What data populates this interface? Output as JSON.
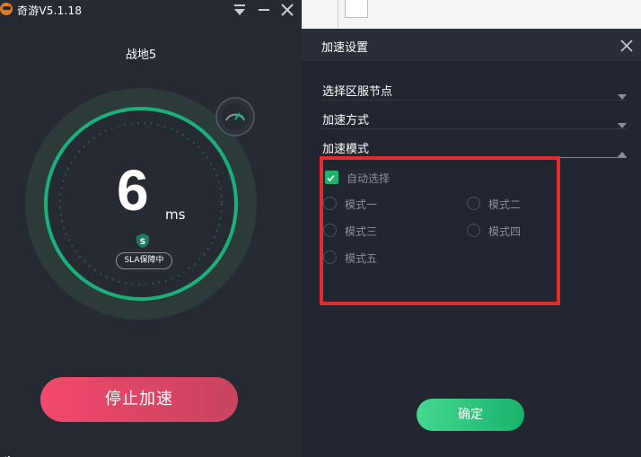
{
  "app": {
    "title": "奇游V5.1.18",
    "game_name": "战地5",
    "ping_value": "6",
    "ping_unit": "ms",
    "sla_label": "SLA保障中",
    "stop_button_label": "停止加速",
    "accent_color": "#1ab07a",
    "stop_color": "#f2486c"
  },
  "panel": {
    "title": "加速设置",
    "dropdowns": [
      {
        "label": "选择区服节点"
      },
      {
        "label": "加速方式"
      },
      {
        "label": "加速模式"
      }
    ],
    "auto_select_label": "自动选择",
    "auto_select_checked": true,
    "modes": [
      {
        "label": "模式一"
      },
      {
        "label": "模式二"
      },
      {
        "label": "模式三"
      },
      {
        "label": "模式四"
      },
      {
        "label": "模式五"
      }
    ],
    "confirm_label": "确定",
    "confirm_color": "#1fb36b"
  },
  "icons": {
    "menu": "menu-icon",
    "minimize": "minimize-icon",
    "close": "close-icon",
    "speedometer": "speedometer-icon",
    "shield": "shield-icon"
  }
}
